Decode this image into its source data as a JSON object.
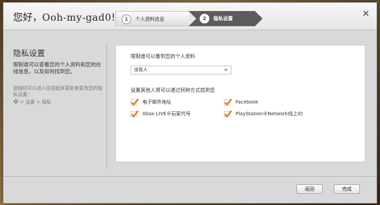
{
  "header": {
    "greeting_prefix": "您好，",
    "username": "Ooh-my-gad0",
    "greeting_suffix": "!",
    "close_icon": "close-icon",
    "steps": [
      {
        "number": "1",
        "label": "个人资料信息"
      },
      {
        "number": "2",
        "label": "隐私设置"
      }
    ]
  },
  "sidebar": {
    "title": "隐私设置",
    "description": "限制谁可以查看您的个人资料和您的在线信息，以及如何找到您。",
    "hint": "您随时可以进入应用程序菜单来更改您的隐私设置：",
    "path": "> 设置 > 隐私",
    "gear_icon": "gear-icon"
  },
  "main": {
    "profile_visibility_label": "限制谁可以看到您的个人资料",
    "profile_visibility_value": "没有人",
    "find_label": "设置其他人将可以通过何种方式找到您",
    "options": [
      {
        "label": "电子邮件地址",
        "checked": true
      },
      {
        "label": "Facebook",
        "checked": true
      },
      {
        "label": "Xbox LIVE®玩家代号",
        "checked": true
      },
      {
        "label": "PlayStation®Network线上ID",
        "checked": true
      }
    ],
    "accent_color": "#e07b10"
  },
  "footer": {
    "back_label": "返回",
    "done_label": "完成"
  }
}
